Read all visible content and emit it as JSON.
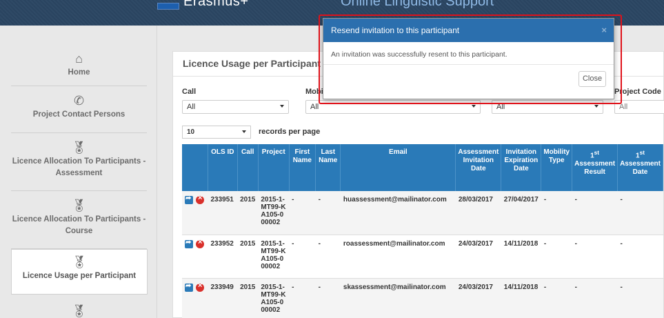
{
  "header": {
    "brand": "Erasmus+",
    "title": "Online Linguistic Support"
  },
  "sidebar": {
    "items": [
      {
        "label": "Home",
        "icon": "home-icon"
      },
      {
        "label": "Project Contact Persons",
        "icon": "phone-icon"
      },
      {
        "label": "Licence Allocation To Participants - Assessment",
        "icon": "award-icon"
      },
      {
        "label": "Licence Allocation To Participants - Course",
        "icon": "award-icon"
      },
      {
        "label": "Licence Usage per Participant",
        "icon": "award-icon"
      },
      {
        "label": "",
        "icon": "award-icon"
      }
    ]
  },
  "panel": {
    "title": "Licence Usage per Participant",
    "filters": {
      "call_label": "Call",
      "call_value": "All",
      "mobility_label": "Mobi",
      "mobility_value": "All",
      "third_value": "All",
      "project_code_label": "Project Code",
      "project_code_value": "All"
    },
    "records": {
      "value": "10",
      "label": "records per page"
    },
    "table": {
      "headers": [
        "",
        "OLS ID",
        "Call",
        "Project",
        "First Name",
        "Last Name",
        "Email",
        "Assessment Invitation Date",
        "Invitation Expiration Date",
        "Mobility Type",
        "1st Assessment Result",
        "1st Assessment Date"
      ],
      "rows": [
        {
          "ols_id": "233951",
          "call": "2015",
          "project": "2015-1-MT99-KA105-000002",
          "first": "-",
          "last": "-",
          "email": "huassessment@mailinator.com",
          "inv_date": "28/03/2017",
          "exp_date": "27/04/2017",
          "mobility": "-",
          "result": "-",
          "date": "-"
        },
        {
          "ols_id": "233952",
          "call": "2015",
          "project": "2015-1-MT99-KA105-000002",
          "first": "-",
          "last": "-",
          "email": "roassessment@mailinator.com",
          "inv_date": "24/03/2017",
          "exp_date": "14/11/2018",
          "mobility": "-",
          "result": "-",
          "date": "-"
        },
        {
          "ols_id": "233949",
          "call": "2015",
          "project": "2015-1-MT99-KA105-000002",
          "first": "-",
          "last": "-",
          "email": "skassessment@mailinator.com",
          "inv_date": "24/03/2017",
          "exp_date": "14/11/2018",
          "mobility": "-",
          "result": "-",
          "date": "-"
        }
      ]
    }
  },
  "modal": {
    "title": "Resend invitation to this participant",
    "message": "An invitation was successfully resent to this participant.",
    "close_label": "Close",
    "close_x": "×"
  }
}
